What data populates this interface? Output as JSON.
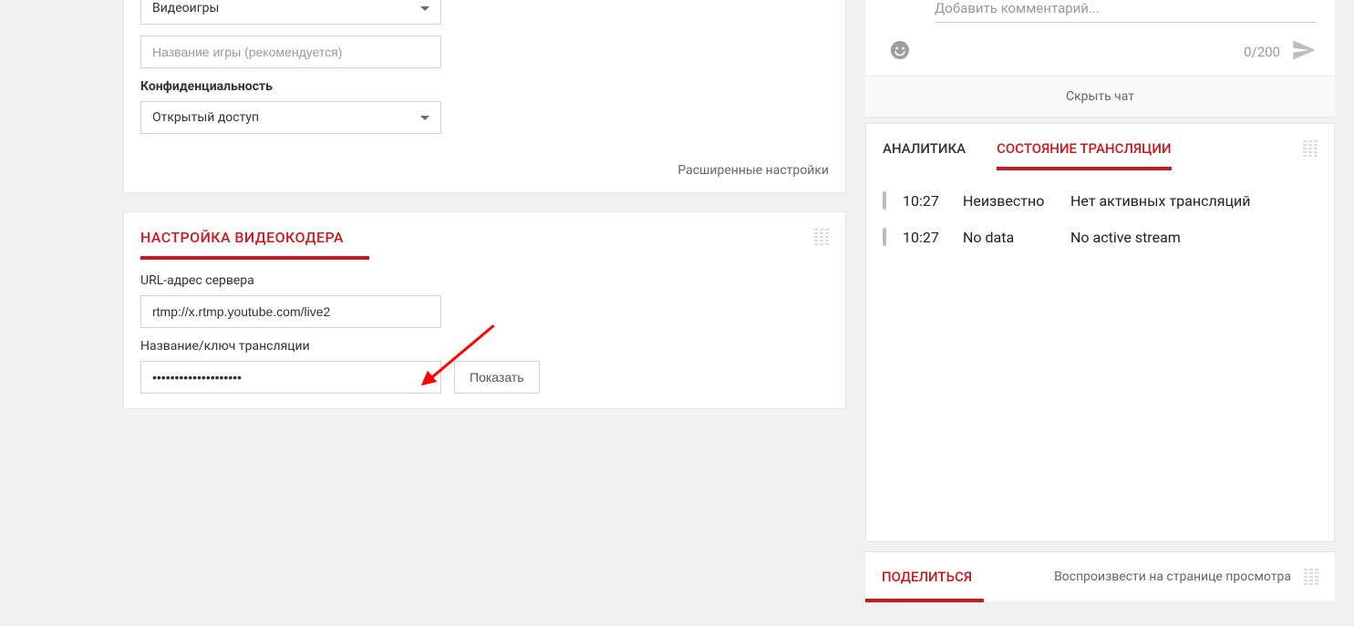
{
  "left": {
    "category_value": "Видеоигры",
    "game_placeholder": "Название игры (рекомендуется)",
    "privacy_label": "Конфиденциальность",
    "privacy_value": "Открытый доступ",
    "advanced_link": "Расширенные настройки",
    "encoder": {
      "title": "НАСТРОЙКА ВИДЕОКОДЕРА",
      "server_url_label": "URL-адрес сервера",
      "server_url_value": "rtmp://x.rtmp.youtube.com/live2",
      "stream_key_label": "Название/ключ трансляции",
      "stream_key_value": "••••••••••••••••••••",
      "show_button": "Показать"
    }
  },
  "chat": {
    "placeholder": "Добавить комментарий...",
    "counter": "0/200",
    "hide_label": "Скрыть чат"
  },
  "tabs": {
    "analytics": "АНАЛИТИКА",
    "stream_state": "СОСТОЯНИЕ ТРАНСЛЯЦИИ"
  },
  "log": [
    {
      "time": "10:27",
      "status": "Неизвестно",
      "msg": "Нет активных трансляций"
    },
    {
      "time": "10:27",
      "status": "No data",
      "msg": "No active stream"
    }
  ],
  "share": {
    "title": "ПОДЕЛИТЬСЯ",
    "watch_link": "Воспроизвести на странице просмотра"
  }
}
